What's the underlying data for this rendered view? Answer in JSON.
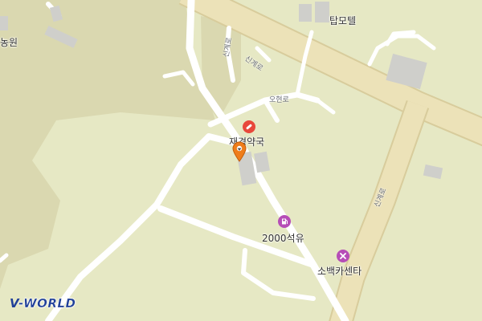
{
  "map": {
    "colors": {
      "land": "#e6e8c4",
      "forest": "#d9d7b0",
      "road_main": "#ebe1b5",
      "road_main_edge": "#d8cc9c",
      "road_minor": "#ffffff",
      "building": "#cfcfcc",
      "pharmacy_icon": "#e8483b",
      "gas_icon": "#b64db7",
      "repair_icon": "#b64db7",
      "marker": "#ef7d1a"
    },
    "places": [
      {
        "id": "nongwon",
        "name": "농원",
        "type": "place"
      },
      {
        "id": "top-motel",
        "name": "탑모텔",
        "type": "lodging"
      },
      {
        "id": "pharmacy",
        "name": "재경약국",
        "type": "pharmacy",
        "icon": "pill-icon"
      },
      {
        "id": "gas",
        "name": "2000석유",
        "type": "gas-station",
        "icon": "fuel-pump-icon"
      },
      {
        "id": "repair",
        "name": "소백카센타",
        "type": "car-repair",
        "icon": "wrench-icon"
      }
    ],
    "roads": [
      {
        "id": "singye-1",
        "name": "신계로"
      },
      {
        "id": "singye-2",
        "name": "신계로"
      },
      {
        "id": "singye-3",
        "name": "신계로"
      },
      {
        "id": "ohyeon",
        "name": "오현로"
      }
    ],
    "marker": {
      "icon": "location-pin-icon"
    }
  },
  "brand": {
    "logo_v": "V",
    "logo_rest": "-WORLD"
  }
}
